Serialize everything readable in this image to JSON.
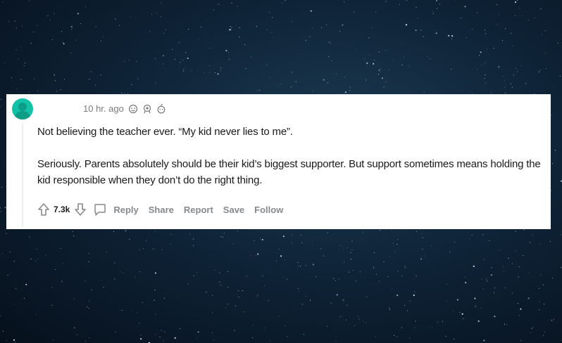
{
  "comment": {
    "timestamp": "10 hr. ago",
    "awards": [
      "wholesome-award-icon",
      "helpful-award-icon",
      "silver-award-icon"
    ],
    "paragraphs": [
      "Not believing the teacher ever. “My kid never lies to me”.",
      "Seriously. Parents absolutely should be their kid’s biggest supporter. But support sometimes means holding the kid responsible when they don’t do the right thing."
    ],
    "score": "7.3k",
    "actions": {
      "reply": "Reply",
      "share": "Share",
      "report": "Report",
      "save": "Save",
      "follow": "Follow"
    }
  },
  "colors": {
    "avatar": "#12c2a6",
    "card": "#ffffff",
    "text": "#1a1a1b",
    "muted": "#878a8c"
  }
}
